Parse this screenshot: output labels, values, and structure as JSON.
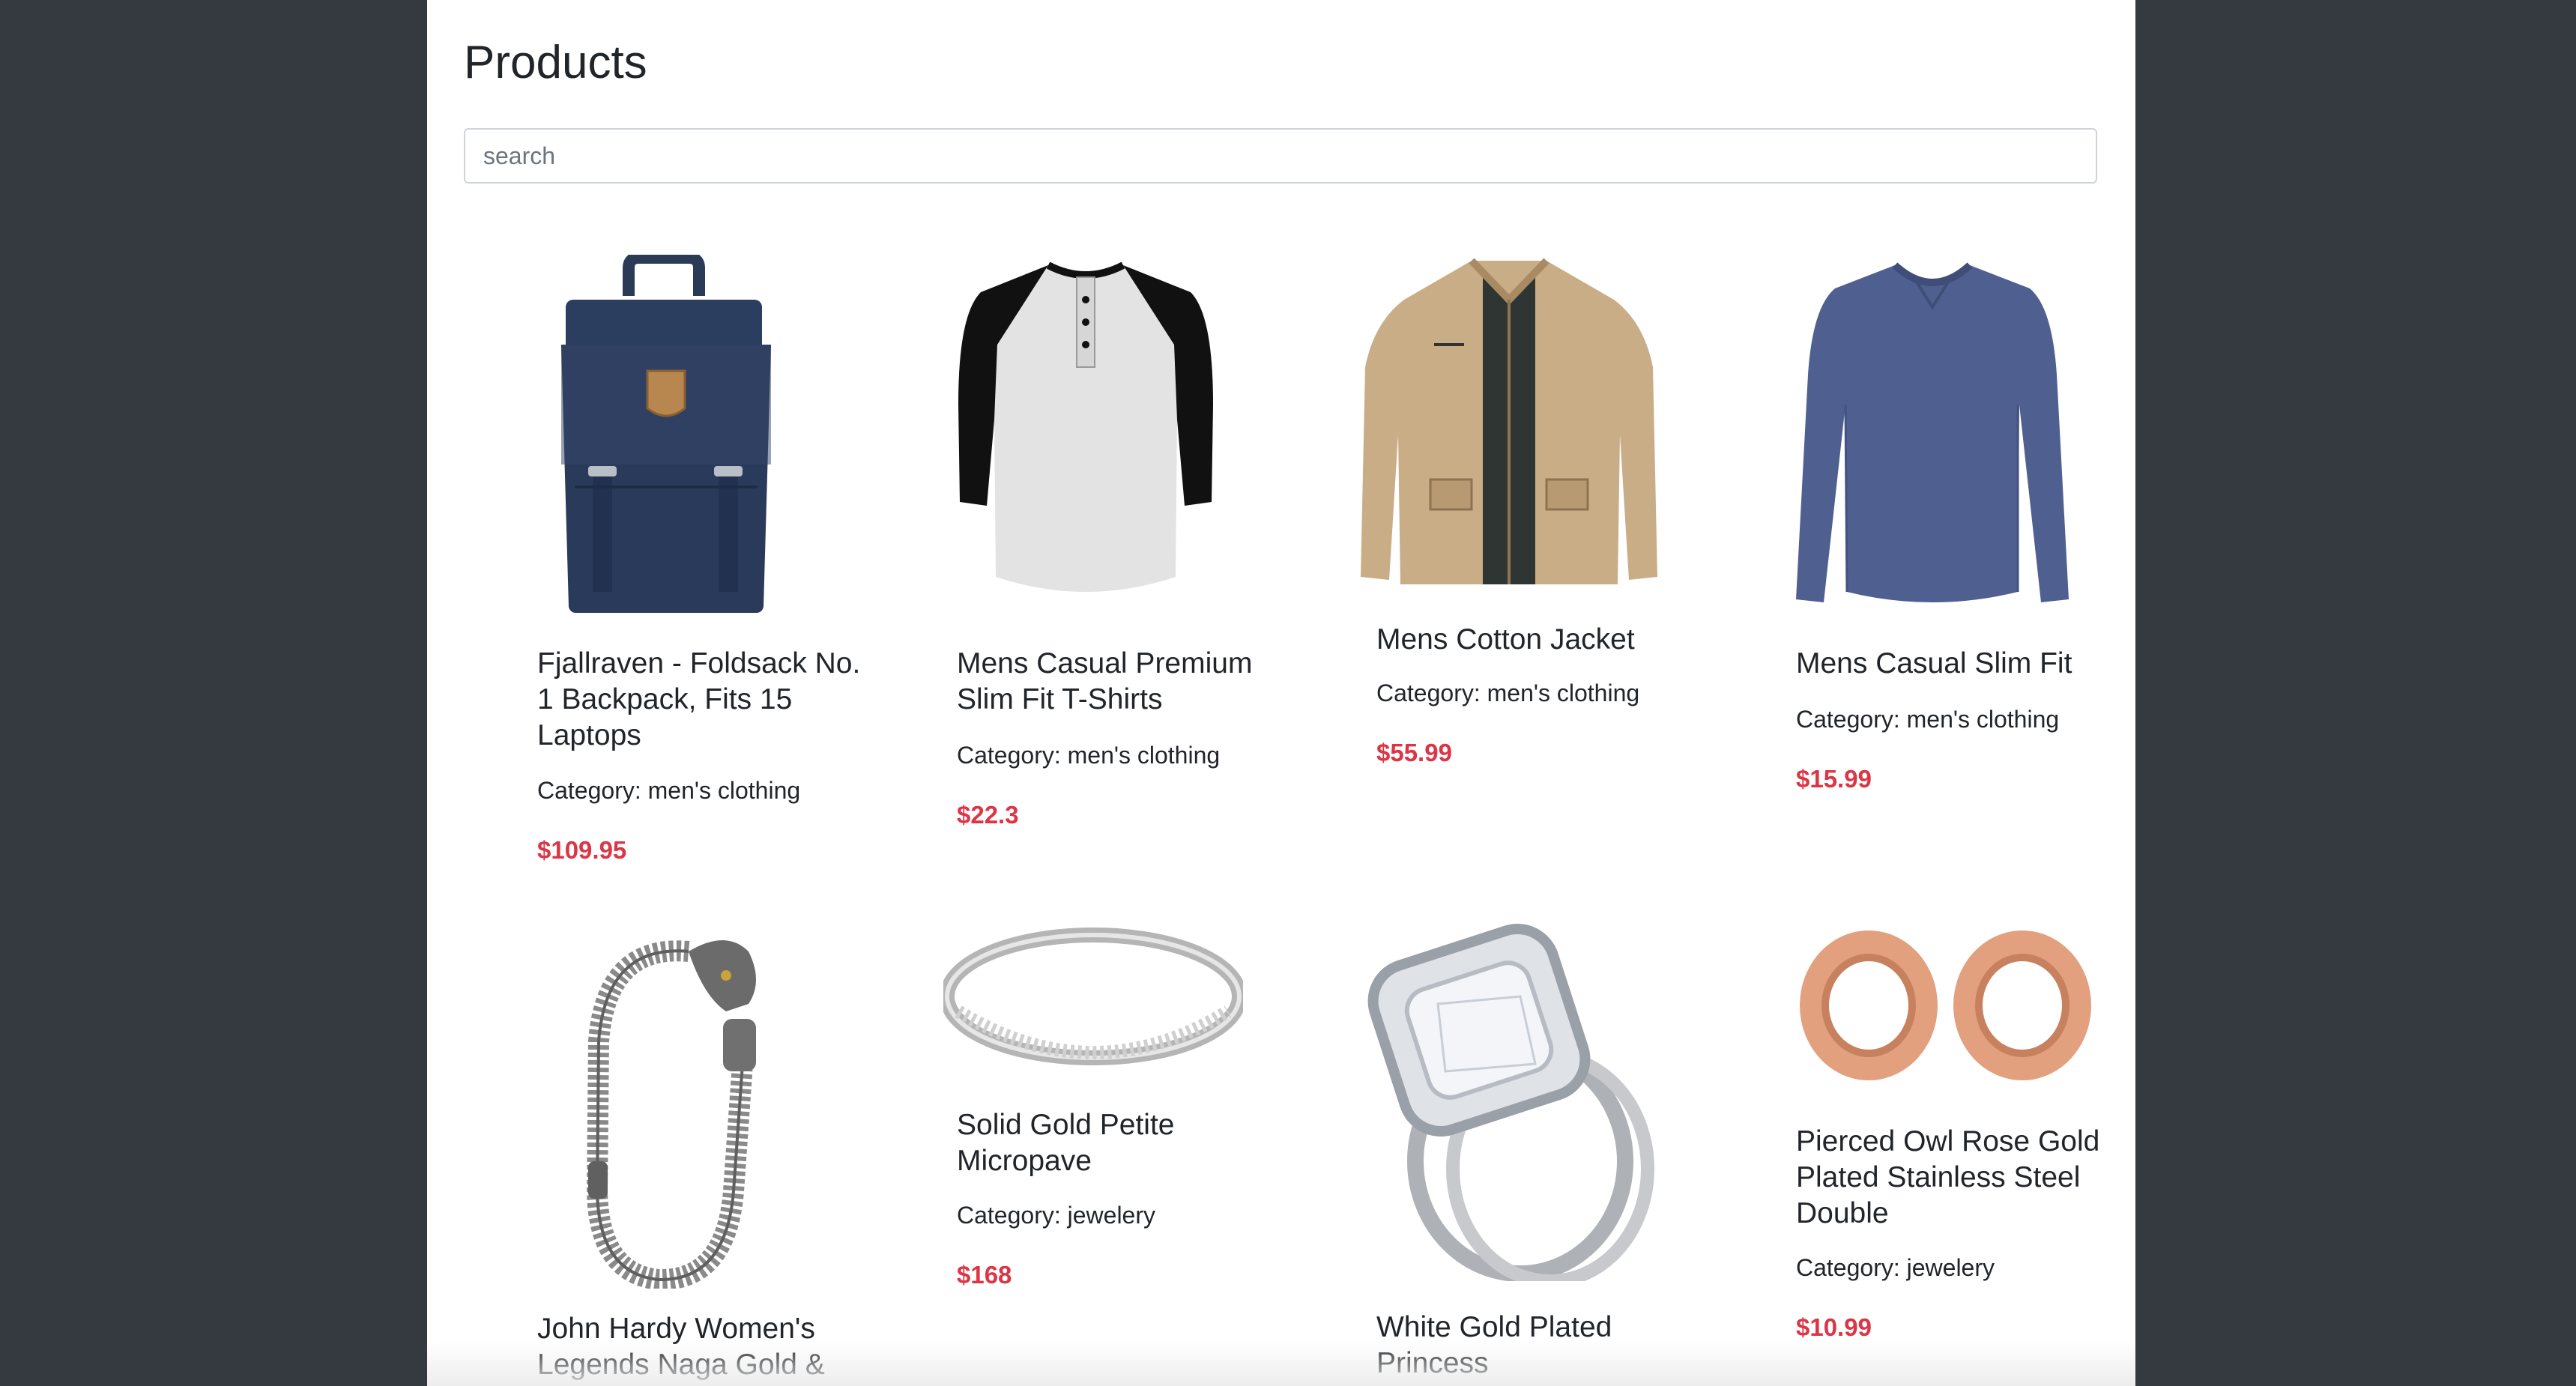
{
  "header": {
    "title": "Products"
  },
  "search": {
    "placeholder": "search",
    "value": ""
  },
  "products": [
    {
      "name": "Fjallraven - Foldsack No. 1 Backpack, Fits 15 Laptops",
      "category": "Category: men's clothing",
      "price": "$109.95",
      "icon": "backpack-image"
    },
    {
      "name": "Mens Casual Premium Slim Fit T-Shirts",
      "category": "Category: men's clothing",
      "price": "$22.3",
      "icon": "raglan-tshirt-image"
    },
    {
      "name": "Mens Cotton Jacket",
      "category": "Category: men's clothing",
      "price": "$55.99",
      "icon": "jacket-image"
    },
    {
      "name": "Mens Casual Slim Fit",
      "category": "Category: men's clothing",
      "price": "$15.99",
      "icon": "long-sleeve-shirt-image"
    },
    {
      "name": "John Hardy Women's Legends Naga Gold &",
      "icon": "bracelet-image"
    },
    {
      "name": "Solid Gold Petite Micropave",
      "category": "Category: jewelery",
      "price": "$168",
      "icon": "ring-image"
    },
    {
      "name": "White Gold Plated Princess",
      "icon": "engagement-ring-image"
    },
    {
      "name": "Pierced Owl Rose Gold Plated Stainless Steel Double",
      "category": "Category: jewelery",
      "price": "$10.99",
      "icon": "ear-tunnel-image"
    }
  ],
  "colors": {
    "page_bg": "#343a40",
    "price": "#dc3545"
  }
}
